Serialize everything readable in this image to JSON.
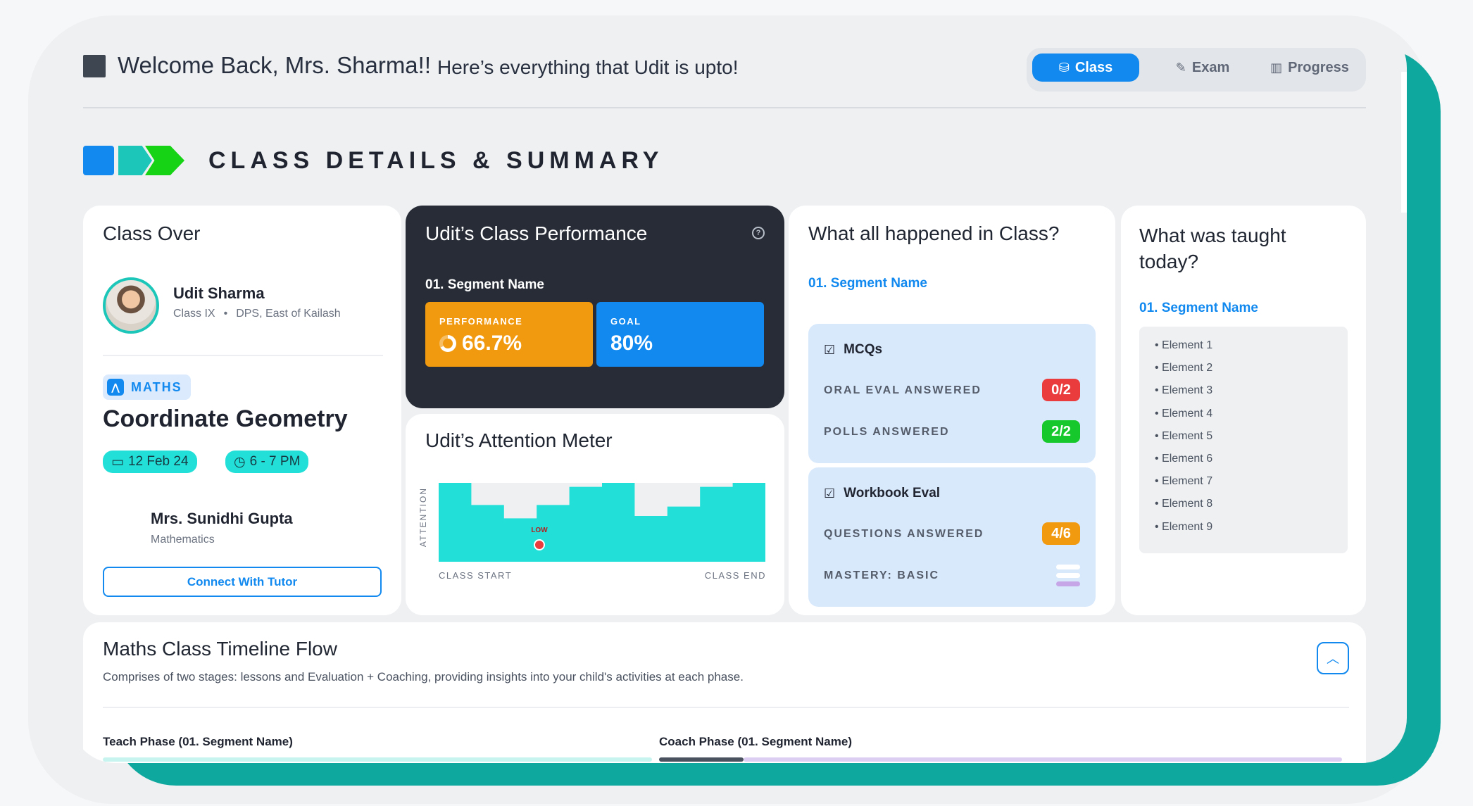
{
  "header": {
    "welcome": "Welcome Back, Mrs. Sharma!!",
    "subtitle": "Here’s everything that Udit is upto!",
    "nav": [
      {
        "label": "Class",
        "icon": "class-icon",
        "active": true
      },
      {
        "label": "Exam",
        "icon": "pencil-icon",
        "active": false
      },
      {
        "label": "Progress",
        "icon": "bar-chart-icon",
        "active": false
      }
    ]
  },
  "section": {
    "title": "CLASS DETAILS & SUMMARY"
  },
  "class_card": {
    "title": "Class Over",
    "student_name": "Udit Sharma",
    "student_class": "Class IX",
    "student_school": "DPS, East of Kailash",
    "subject": "MATHS",
    "topic": "Coordinate Geometry",
    "date": "12 Feb 24",
    "time": "6 - 7 PM",
    "tutor_name": "Mrs. Sunidhi Gupta",
    "tutor_subject": "Mathematics",
    "connect_label": "Connect With Tutor"
  },
  "performance": {
    "title": "Udit’s Class Performance",
    "segment": "01. Segment Name",
    "performance_label": "PERFORMANCE",
    "performance_value": "66.7%",
    "performance_fraction": 0.667,
    "goal_label": "GOAL",
    "goal_value": "80%"
  },
  "attention": {
    "title": "Udit’s Attention Meter",
    "y_label": "ATTENTION",
    "start_label": "CLASS START",
    "end_label": "CLASS END",
    "low_label": "LOW",
    "levels": [
      1.0,
      0.72,
      0.55,
      0.72,
      0.95,
      1.0,
      0.58,
      0.7,
      0.95,
      1.0
    ],
    "fill_color": "#22e0d8",
    "track_color": "#eef0f2",
    "marker_color": "#ea3c3c"
  },
  "happened": {
    "title": "What all happened in Class?",
    "segment": "01. Segment Name",
    "mcq_title": "MCQs",
    "oral_label": "ORAL EVAL ANSWERED",
    "oral_score": "0/2",
    "polls_label": "POLLS ANSWERED",
    "polls_score": "2/2",
    "workbook_title": "Workbook Eval",
    "questions_label": "QUESTIONS ANSWERED",
    "questions_score": "4/6",
    "mastery_label": "MASTERY: BASIC",
    "mastery_level": 1,
    "mastery_levels_total": 3
  },
  "taught": {
    "title": "What was taught today?",
    "segment": "01. Segment Name",
    "elements": [
      "Element 1",
      "Element 2",
      "Element 3",
      "Element 4",
      "Element 5",
      "Element 6",
      "Element 7",
      "Element 8",
      "Element 9"
    ]
  },
  "timeline": {
    "title": "Maths Class Timeline Flow",
    "description": "Comprises of two stages: lessons and Evaluation + Coaching, providing insights into your child's activities at each phase.",
    "teach_phase": "Teach Phase (01. Segment Name)",
    "coach_phase": "Coach Phase (01. Segment Name)"
  },
  "colors": {
    "primary": "#1189ef",
    "teal": "#1cc6b9",
    "green": "#16d315",
    "orange": "#f19a10",
    "red": "#ea3c3c",
    "dark_card": "#272c36"
  }
}
